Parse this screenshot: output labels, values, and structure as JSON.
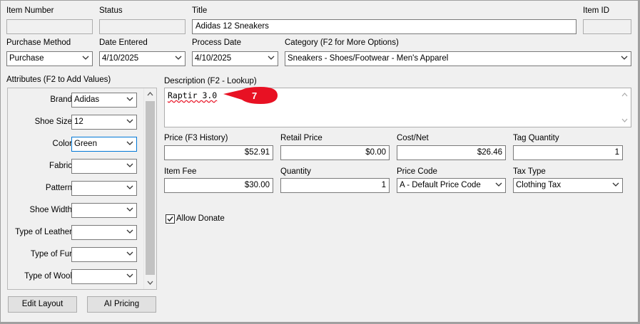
{
  "header": {
    "item_number_label": "Item Number",
    "item_number_value": "",
    "status_label": "Status",
    "status_value": "",
    "title_label": "Title",
    "title_value": "Adidas 12 Sneakers",
    "item_id_label": "Item ID",
    "item_id_value": ""
  },
  "row2": {
    "purchase_method_label": "Purchase Method",
    "purchase_method_value": "Purchase",
    "date_entered_label": "Date Entered",
    "date_entered_value": "4/10/2025",
    "process_date_label": "Process Date",
    "process_date_value": "4/10/2025",
    "category_label": "Category (F2 for More Options)",
    "category_value": "Sneakers - Shoes/Footwear - Men's Apparel"
  },
  "attributes": {
    "label": "Attributes (F2 to Add Values)",
    "items": [
      {
        "label": "Brand",
        "value": "Adidas"
      },
      {
        "label": "Shoe Size",
        "value": "12"
      },
      {
        "label": "Color",
        "value": "Green"
      },
      {
        "label": "Fabric",
        "value": ""
      },
      {
        "label": "Pattern",
        "value": ""
      },
      {
        "label": "Shoe Width",
        "value": ""
      },
      {
        "label": "Type of Leather",
        "value": ""
      },
      {
        "label": "Type of Fur",
        "value": ""
      },
      {
        "label": "Type of Wool",
        "value": ""
      }
    ]
  },
  "description": {
    "label": "Description (F2 - Lookup)",
    "value": "Raptir 3.0",
    "badge": "7"
  },
  "pricing": {
    "price_label": "Price (F3 History)",
    "price_value": "$52.91",
    "retail_label": "Retail Price",
    "retail_value": "$0.00",
    "cost_label": "Cost/Net",
    "cost_value": "$26.46",
    "tag_qty_label": "Tag Quantity",
    "tag_qty_value": "1",
    "item_fee_label": "Item Fee",
    "item_fee_value": "$30.00",
    "quantity_label": "Quantity",
    "quantity_value": "1",
    "price_code_label": "Price Code",
    "price_code_value": "A - Default Price Code",
    "tax_type_label": "Tax Type",
    "tax_type_value": "Clothing Tax"
  },
  "allow_donate": {
    "label": "Allow Donate",
    "checked": true
  },
  "buttons": {
    "edit_layout": "Edit Layout",
    "ai_pricing": "AI Pricing"
  },
  "colors": {
    "badge": "#e81123",
    "scroll_thumb": "#c2c2c2"
  }
}
